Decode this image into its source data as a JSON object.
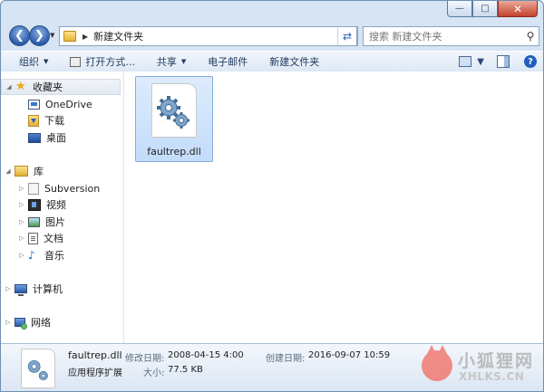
{
  "window": {
    "caption_buttons": {
      "minimize": "—",
      "maximize": "□",
      "close": "✕"
    }
  },
  "address_bar": {
    "path": "新建文件夹",
    "search_placeholder": "搜索 新建文件夹"
  },
  "toolbar": {
    "organize": "组织",
    "open_with": "打开方式...",
    "share": "共享",
    "email": "电子邮件",
    "new_folder": "新建文件夹"
  },
  "sidebar": {
    "favorites": {
      "label": "收藏夹",
      "items": [
        {
          "label": "OneDrive"
        },
        {
          "label": "下载"
        },
        {
          "label": "桌面"
        }
      ]
    },
    "libraries": {
      "label": "库",
      "items": [
        {
          "label": "Subversion"
        },
        {
          "label": "视频"
        },
        {
          "label": "图片"
        },
        {
          "label": "文档"
        },
        {
          "label": "音乐"
        }
      ]
    },
    "computer": {
      "label": "计算机"
    },
    "network": {
      "label": "网络"
    }
  },
  "files": [
    {
      "name": "faultrep.dll",
      "icon": "dll-gear-icon",
      "selected": true
    }
  ],
  "details": {
    "name": "faultrep.dll",
    "type": "应用程序扩展",
    "modified_label": "修改日期:",
    "modified_value": "2008-04-15 4:00",
    "size_label": "大小:",
    "size_value": "77.5 KB",
    "created_label": "创建日期:",
    "created_value": "2016-09-07 10:59"
  },
  "watermark": {
    "cn": "小狐狸网",
    "en": "XHLKS.CN"
  },
  "colors": {
    "frame": "#d6e4f4",
    "selection": "#cce2fb",
    "link_text": "#1e395b"
  }
}
